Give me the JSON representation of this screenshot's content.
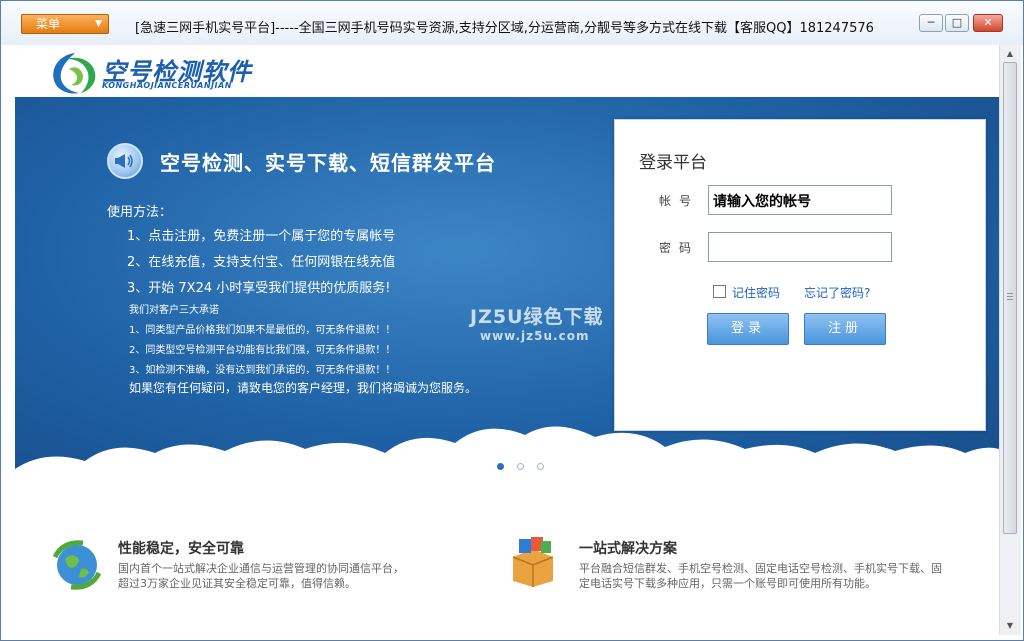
{
  "window": {
    "menu_label": "菜单",
    "title": "[急速三网手机实号平台]-----全国三网手机号码实号资源,支持分区域,分运营商,分靓号等多方式在线下载【客服QQ】181247576",
    "controls": {
      "minimize": "─",
      "maximize": "□",
      "close": "✕"
    }
  },
  "logo": {
    "title": "空号检测软件",
    "subtitle": "KONGHAOJIANCERUANJIAN"
  },
  "hero": {
    "title": "空号检测、实号下载、短信群发平台",
    "how_label": "使用方法：",
    "steps": [
      "1、点击注册，免费注册一个属于您的专属帐号",
      "2、在线充值，支持支付宝、任何网银在线充值",
      "3、开始 7X24 小时享受我们提供的优质服务!"
    ],
    "promise_title": "我们对客户三大承诺",
    "promises": [
      "1、同类型产品价格我们如果不是最低的，可无条件退款！！",
      "2、同类型空号检测平台功能有比我们强，可无条件退款！！",
      "3、如检测不准确，没有达到我们承诺的，可无条件退款！！"
    ],
    "contact": "如果您有任何疑问，请致电您的客户经理，我们将竭诚为您服务。",
    "slides": 3,
    "active_slide": 0
  },
  "watermark": {
    "line1": "JZ5U绿色下载",
    "line2": "www.jz5u.com"
  },
  "login": {
    "title": "登录平台",
    "username_label": "帐号",
    "username_value": "请输入您的帐号",
    "password_label": "密码",
    "remember_label": "记住密码",
    "forgot_label": "忘记了密码?",
    "login_button": "登录",
    "register_button": "注册"
  },
  "features": [
    {
      "title": "性能稳定，安全可靠",
      "desc_line1": "国内首个一站式解决企业通信与运营管理的协同通信平台，",
      "desc_line2": "超过3万家企业见证其安全稳定可靠，值得信赖。"
    },
    {
      "title": "一站式解决方案",
      "desc_line1": "平台融合短信群发、手机空号检测、固定电话空号检测、手机实号下载、固",
      "desc_line2": "定电话实号下载多种应用，只需一个账号即可使用所有功能。"
    }
  ],
  "colors": {
    "hero_blue": "#1f62a6",
    "button_blue": "#4a95dd",
    "link_blue": "#1f60c4",
    "menu_orange": "#e67a12"
  }
}
